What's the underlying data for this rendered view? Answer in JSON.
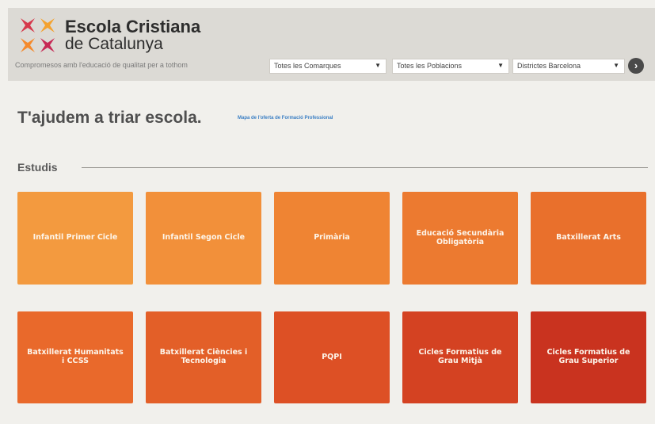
{
  "header": {
    "brand_line1": "Escola Cristiana",
    "brand_line2": "de Catalunya",
    "tagline": "Compromesos amb l'educació de qualitat per a tothom",
    "logo_colors": [
      "#d6394b",
      "#f4a22f",
      "#f58a2d",
      "#c72a55"
    ],
    "filters": [
      {
        "value": "Totes les Comarques"
      },
      {
        "value": "Totes les Poblacions"
      },
      {
        "value": "Districtes Barcelona"
      }
    ],
    "go_icon": "arrow-right-circle-icon"
  },
  "main": {
    "title": "T'ajudem a triar escola.",
    "fp_link": "Mapa de l'oferta de Formació Professional"
  },
  "estudis": {
    "heading": "Estudis",
    "tiles": [
      {
        "label": "Infantil Primer Cicle",
        "color": "#f39a3f"
      },
      {
        "label": "Infantil Segon Cicle",
        "color": "#f2903a"
      },
      {
        "label": "Primària",
        "color": "#ef8433"
      },
      {
        "label": "Educació Secundària Obligatòria",
        "color": "#ec7a30"
      },
      {
        "label": "Batxillerat Arts",
        "color": "#e9702c"
      },
      {
        "label": "Batxillerat Humanitats i CCSS",
        "color": "#e9692b"
      },
      {
        "label": "Batxillerat Ciències i Tecnologia",
        "color": "#e35f28"
      },
      {
        "label": "PQPI",
        "color": "#dd5025"
      },
      {
        "label": "Cicles Formatius de Grau Mitjà",
        "color": "#d44222"
      },
      {
        "label": "Cicles Formatius de Grau Superior",
        "color": "#c9331f"
      }
    ]
  }
}
